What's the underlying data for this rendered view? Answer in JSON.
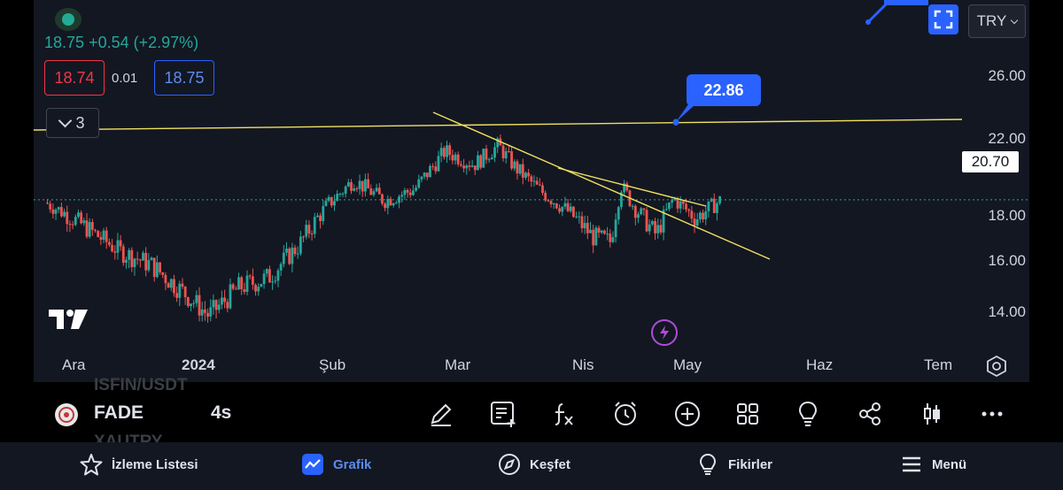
{
  "ticker": {
    "price": "18.75",
    "change": "+0.54",
    "change_pct": "(+2.97%)",
    "bid": "18.74",
    "spread": "0.01",
    "ask": "18.75",
    "collapse_count": "3"
  },
  "header": {
    "currency": "TRY"
  },
  "chart": {
    "current_price_label": "20.70",
    "callout_value": "22.86",
    "y_ticks": [
      "26.00",
      "22.00",
      "18.00",
      "16.00",
      "14.00"
    ],
    "x_ticks": [
      "Ara",
      "2024",
      "Şub",
      "Mar",
      "Nis",
      "May",
      "Haz",
      "Tem"
    ],
    "up_color": "#26a69a",
    "down_color": "#ef5350",
    "trendline_color": "#f0e060"
  },
  "chart_data": {
    "type": "candlestick",
    "y_ticks": [
      26.0,
      22.0,
      18.0,
      16.0,
      14.0
    ],
    "x_ticks": [
      "Ara",
      "2024",
      "Şub",
      "Mar",
      "Nis",
      "May",
      "Haz",
      "Tem"
    ],
    "close_path": [
      {
        "t": "2023-11-24",
        "v": 18.6
      },
      {
        "t": "2023-12-04",
        "v": 17.4
      },
      {
        "t": "2023-12-12",
        "v": 16.4
      },
      {
        "t": "2023-12-20",
        "v": 15.8
      },
      {
        "t": "2023-12-28",
        "v": 14.7
      },
      {
        "t": "2024-01-03",
        "v": 13.8
      },
      {
        "t": "2024-01-10",
        "v": 14.9
      },
      {
        "t": "2024-01-17",
        "v": 15.3
      },
      {
        "t": "2024-01-24",
        "v": 16.6
      },
      {
        "t": "2024-01-31",
        "v": 18.5
      },
      {
        "t": "2024-02-06",
        "v": 19.8
      },
      {
        "t": "2024-02-13",
        "v": 18.7
      },
      {
        "t": "2024-02-20",
        "v": 19.3
      },
      {
        "t": "2024-02-27",
        "v": 21.3
      },
      {
        "t": "2024-03-05",
        "v": 20.6
      },
      {
        "t": "2024-03-11",
        "v": 21.6
      },
      {
        "t": "2024-03-15",
        "v": 20.5
      },
      {
        "t": "2024-03-21",
        "v": 19.3
      },
      {
        "t": "2024-03-28",
        "v": 18.2
      },
      {
        "t": "2024-04-04",
        "v": 17.0
      },
      {
        "t": "2024-04-09",
        "v": 16.8
      },
      {
        "t": "2024-04-12",
        "v": 19.5
      },
      {
        "t": "2024-04-16",
        "v": 18.3
      },
      {
        "t": "2024-04-22",
        "v": 17.1
      },
      {
        "t": "2024-04-27",
        "v": 18.8
      },
      {
        "t": "2024-05-03",
        "v": 17.8
      },
      {
        "t": "2024-05-09",
        "v": 18.75
      }
    ],
    "indicators": {
      "horizontal_line": 22.86,
      "last_price": 18.75,
      "current_price_label": 20.7
    }
  },
  "toolbar": {
    "symbol": "FADE",
    "interval": "4s",
    "ghost_above": "ISFIN/USDT",
    "ghost_below": "XAUTRY"
  },
  "nav": {
    "watchlist": "İzleme Listesi",
    "chart": "Grafik",
    "explore": "Keşfet",
    "ideas": "Fikirler",
    "menu": "Menü"
  }
}
